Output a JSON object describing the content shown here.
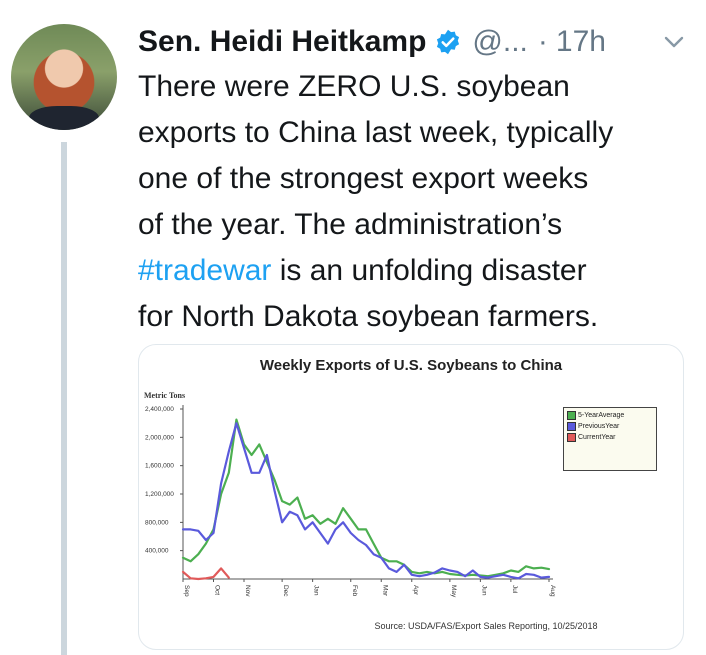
{
  "author": {
    "name": "Sen. Heidi Heitkamp",
    "handle": "@...",
    "separator": "·",
    "time": "17h",
    "verified_icon": "verified-badge-icon",
    "menu_icon": "chevron-down-icon"
  },
  "tweet": {
    "line1": "There were ZERO U.S. soybean",
    "line2": "exports to China last week, typically",
    "line3": "one of the strongest export weeks",
    "line4": "of the year. The administration’s",
    "hashtag": "#tradewar",
    "line5_rest": " is an unfolding disaster",
    "line6": "for North Dakota soybean farmers."
  },
  "colors": {
    "link": "#1da1f2",
    "five_year": "#4caf50",
    "previous_year": "#5a5adc",
    "current_year": "#e05a5a"
  },
  "chart_data": {
    "type": "line",
    "title": "Weekly Exports of U.S. Soybeans to China",
    "ylabel": "Metric Tons",
    "source": "Source: USDA/FAS/Export Sales Reporting, 10/25/2018",
    "ylim": [
      0,
      2400000
    ],
    "yticks": [
      "2,400,000",
      "2,000,000",
      "1,600,000",
      "1,200,000",
      "800,000",
      "400,000"
    ],
    "ytick_values": [
      2400000,
      2000000,
      1600000,
      1200000,
      800000,
      400000
    ],
    "xticks": [
      "Sep",
      "Oct",
      "Nov",
      "Dec",
      "Jan",
      "Feb",
      "Mar",
      "Apr",
      "May",
      "Jun",
      "Jul",
      "Aug"
    ],
    "xtick_weeks": [
      0,
      4,
      8,
      13,
      17,
      22,
      26,
      30,
      35,
      39,
      43,
      48
    ],
    "legend_position": "top-right",
    "series": [
      {
        "name": "5-YearAverage",
        "values": [
          300000,
          250000,
          350000,
          500000,
          700000,
          1200000,
          1500000,
          2250000,
          1900000,
          1750000,
          1900000,
          1650000,
          1400000,
          1100000,
          1050000,
          1150000,
          850000,
          900000,
          780000,
          850000,
          780000,
          1000000,
          850000,
          700000,
          700000,
          500000,
          300000,
          250000,
          250000,
          200000,
          100000,
          80000,
          100000,
          80000,
          100000,
          70000,
          60000,
          50000,
          60000,
          50000,
          40000,
          60000,
          80000,
          120000,
          100000,
          180000,
          150000,
          160000,
          140000
        ]
      },
      {
        "name": "PreviousYear",
        "values": [
          700000,
          700000,
          680000,
          550000,
          650000,
          1350000,
          1800000,
          2200000,
          1850000,
          1500000,
          1500000,
          1750000,
          1250000,
          800000,
          950000,
          900000,
          700000,
          800000,
          650000,
          500000,
          700000,
          800000,
          650000,
          550000,
          480000,
          350000,
          300000,
          150000,
          100000,
          200000,
          60000,
          40000,
          60000,
          90000,
          150000,
          120000,
          100000,
          40000,
          120000,
          30000,
          20000,
          40000,
          60000,
          30000,
          10000,
          70000,
          60000,
          20000,
          30000
        ]
      },
      {
        "name": "CurrentYear",
        "values": [
          100000,
          10000,
          0,
          10000,
          30000,
          150000,
          20000
        ]
      }
    ]
  }
}
